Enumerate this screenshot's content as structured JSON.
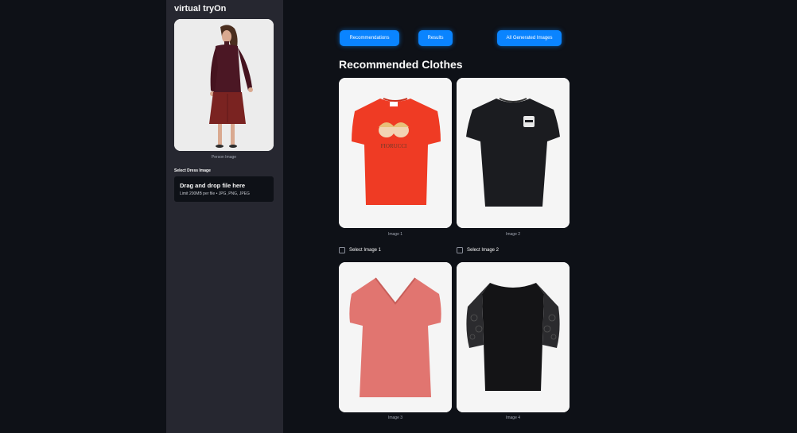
{
  "sidebar": {
    "app_title": "virtual tryOn",
    "person_caption": "Person Image",
    "dress_label": "Select Dress Image",
    "uploader": {
      "title": "Drag and drop file here",
      "subtitle": "Limit 200MB per file • JPG, PNG, JPEG"
    }
  },
  "nav": {
    "recommendations": "Recommendations",
    "results": "Results",
    "all_generated": "All Generated Images"
  },
  "main": {
    "heading": "Recommended Clothes",
    "items": [
      {
        "caption": "Image 1",
        "select_label": "Select Image 1",
        "color": "#ef3b24"
      },
      {
        "caption": "Image 2",
        "select_label": "Select Image 2",
        "color": "#1b1c20"
      },
      {
        "caption": "Image 3",
        "select_label": "",
        "color": "#e17570"
      },
      {
        "caption": "Image 4",
        "select_label": "",
        "color": "#141416"
      }
    ],
    "print_text": "FIORUCCI"
  },
  "colors": {
    "accent": "#0a84ff",
    "sidebar_bg": "#262730",
    "page_bg": "#0e1117"
  }
}
